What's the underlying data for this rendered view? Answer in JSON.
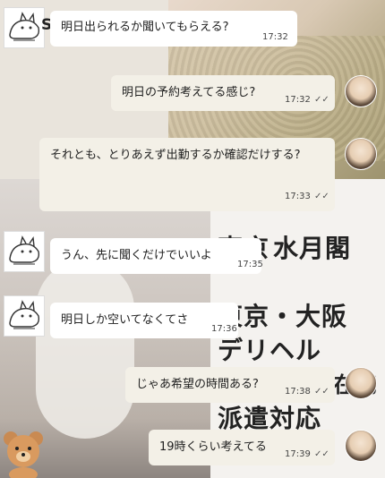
{
  "background": {
    "overlay_lines": [
      "東京",
      "水月閣",
      "東京・大阪",
      "デリヘル",
      "在宅",
      "派遣対応"
    ]
  },
  "messages": [
    {
      "direction": "in",
      "sender_initial": "S",
      "text": "明日出られるか聞いてもらえる?",
      "time": "17:32",
      "read": false
    },
    {
      "direction": "out",
      "text": "明日の予約考えてる感じ?",
      "time": "17:32",
      "read": true
    },
    {
      "direction": "out",
      "text": "それとも、とりあえず出勤するか確認だけする?",
      "time": "17:33",
      "read": true
    },
    {
      "direction": "in",
      "text": "うん、先に聞くだけでいいよ",
      "time": "17:35",
      "read": false
    },
    {
      "direction": "in",
      "text": "明日しか空いてなくてさ",
      "time": "17:36",
      "read": false
    },
    {
      "direction": "out",
      "text": "じゃあ希望の時間ある?",
      "time": "17:38",
      "read": true
    },
    {
      "direction": "out",
      "text": "19時くらい考えてる",
      "time": "17:39",
      "read": true
    }
  ],
  "icons": {
    "contact_avatar": "cat-sketch-avatar",
    "self_avatar": "girl-photo-avatar",
    "read_receipt": "double-check-icon"
  },
  "checkmark": "✓✓"
}
